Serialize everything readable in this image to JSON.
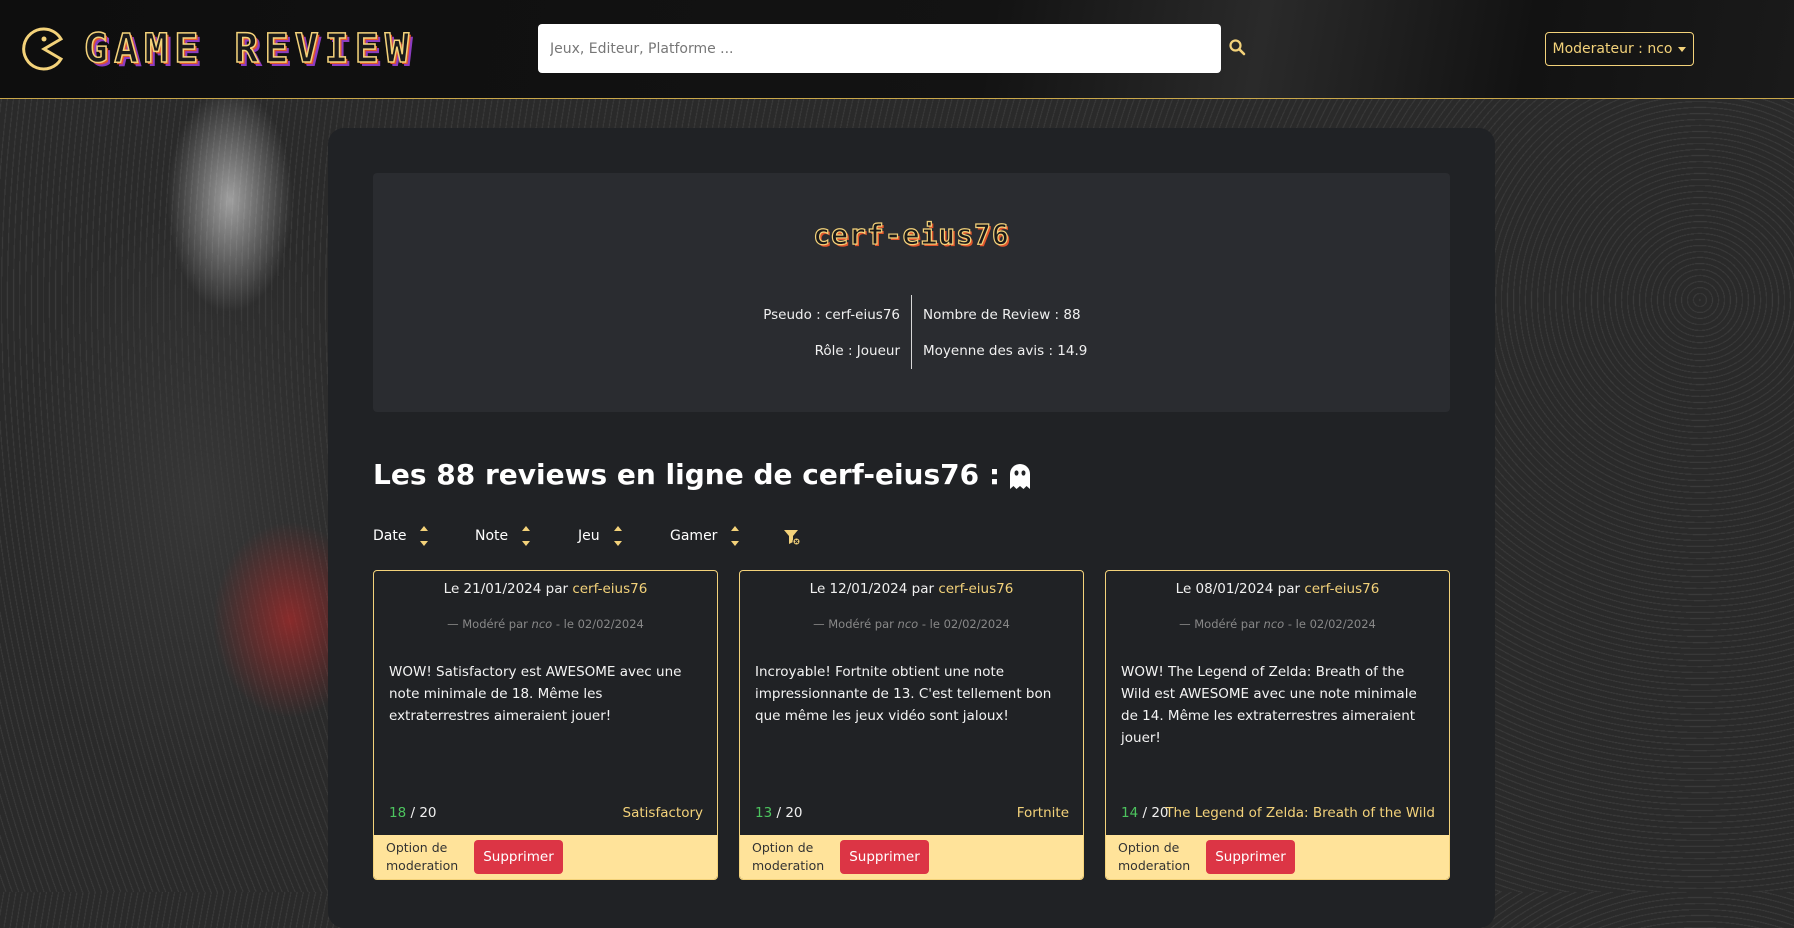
{
  "header": {
    "logo_text": "GAME REVIEW",
    "search_placeholder": "Jeux, Editeur, Platforme ...",
    "moderator_label": "Moderateur : nco"
  },
  "profile": {
    "name": "cerf-eius76",
    "pseudo": "Pseudo : cerf-eius76",
    "role": "Rôle : Joueur",
    "review_count": "Nombre de Review : 88",
    "average": "Moyenne des avis : 14.9"
  },
  "reviews_title": "Les 88 reviews en ligne de cerf-eius76 :",
  "sort": {
    "date": "Date",
    "note": "Note",
    "jeu": "Jeu",
    "gamer": "Gamer"
  },
  "cards": [
    {
      "date_prefix": "Le 21/01/2024 par ",
      "author": "cerf-eius76",
      "mod_prefix": "— Modéré par ",
      "mod_by": "nco",
      "mod_suffix": " - le 02/02/2024",
      "text": "WOW! Satisfactory est AWESOME avec une note minimale de 18. Même les extraterrestres aimeraient jouer!",
      "score": "18",
      "score_max": " / 20",
      "game": "Satisfactory",
      "option_label": "Option de moderation",
      "delete_label": "Supprimer"
    },
    {
      "date_prefix": "Le 12/01/2024 par ",
      "author": "cerf-eius76",
      "mod_prefix": "— Modéré par ",
      "mod_by": "nco",
      "mod_suffix": " - le 02/02/2024",
      "text": "Incroyable! Fortnite obtient une note impressionnante de 13. C'est tellement bon que même les jeux vidéo sont jaloux!",
      "score": "13",
      "score_max": " / 20",
      "game": "Fortnite",
      "option_label": "Option de moderation",
      "delete_label": "Supprimer"
    },
    {
      "date_prefix": "Le 08/01/2024 par ",
      "author": "cerf-eius76",
      "mod_prefix": "— Modéré par ",
      "mod_by": "nco",
      "mod_suffix": " - le 02/02/2024",
      "text": "WOW! The Legend of Zelda: Breath of the Wild est AWESOME avec une note minimale de 14. Même les extraterrestres aimeraient jouer!",
      "score": "14",
      "score_max": " / 20",
      "game": "The Legend of Zelda: Breath of the Wild",
      "option_label": "Option de moderation",
      "delete_label": "Supprimer"
    }
  ],
  "colors": {
    "accent": "#f3d27a",
    "score_green": "#4cc45e",
    "delete_red": "#dc3545",
    "panel": "#202225"
  }
}
